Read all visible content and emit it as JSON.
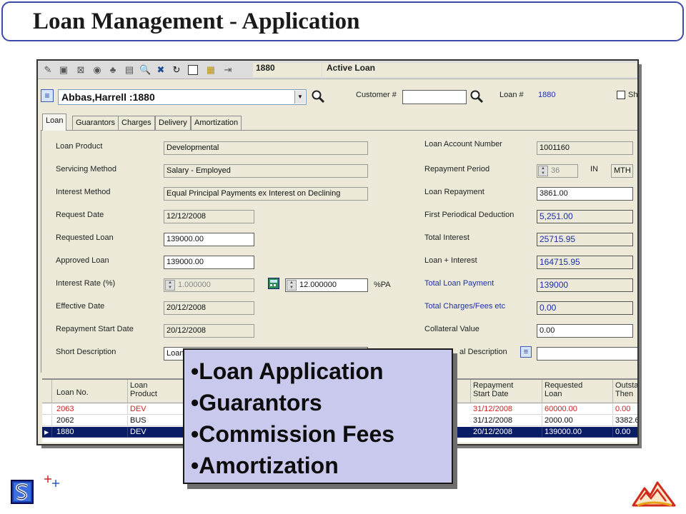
{
  "slide": {
    "title": "Loan Management - Application"
  },
  "toolbar": {
    "loan_number": "1880",
    "status": "Active Loan"
  },
  "search": {
    "borrower_combo": "Abbas,Harrell :1880",
    "customer_label": "Customer #",
    "customer_value": "",
    "loan_label": "Loan #",
    "loan_value": "1880",
    "show_label": "Sh"
  },
  "tabs": [
    {
      "label": "Loan",
      "active": true
    },
    {
      "label": "Guarantors"
    },
    {
      "label": "Charges"
    },
    {
      "label": "Delivery"
    },
    {
      "label": "Amortization"
    }
  ],
  "form_left": {
    "loan_product": {
      "label": "Loan Product",
      "value": "Developmental"
    },
    "servicing_method": {
      "label": "Servicing Method",
      "value": "Salary - Employed"
    },
    "interest_method": {
      "label": "Interest Method",
      "value": "Equal Principal Payments ex Interest on Declining"
    },
    "request_date": {
      "label": "Request Date",
      "value": "12/12/2008"
    },
    "requested_loan": {
      "label": "Requested Loan",
      "value": "139000.00"
    },
    "approved_loan": {
      "label": "Approved Loan",
      "value": "139000.00"
    },
    "interest_rate": {
      "label": "Interest Rate (%)",
      "value_1": "1.000000",
      "value_2": "12.000000",
      "unit": "%PA"
    },
    "effective_date": {
      "label": "Effective Date",
      "value": "20/12/2008"
    },
    "repayment_start_date": {
      "label": "Repayment Start Date",
      "value": "20/12/2008"
    },
    "short_description": {
      "label": "Short Description",
      "value": "Loan"
    }
  },
  "form_right": {
    "loan_account_number": {
      "label": "Loan Account Number",
      "value": "1001160"
    },
    "repayment_period": {
      "label": "Repayment Period",
      "value": "36",
      "in_label": "IN",
      "unit": "MTH"
    },
    "loan_repayment": {
      "label": "Loan Repayment",
      "value": "3861.00"
    },
    "first_periodical_deduction": {
      "label": "First Periodical Deduction",
      "value": "5,251.00"
    },
    "total_interest": {
      "label": "Total Interest",
      "value": "25715.95"
    },
    "loan_plus_interest": {
      "label": "Loan + Interest",
      "value": "164715.95"
    },
    "total_loan_payment": {
      "label": "Total Loan Payment",
      "value": "139000"
    },
    "total_charges_fees": {
      "label": "Total Charges/Fees etc",
      "value": "0.00"
    },
    "collateral_value": {
      "label": "Collateral Value",
      "value": "0.00"
    },
    "collateral_description": {
      "label": "al Description",
      "value": ""
    }
  },
  "grid": {
    "headers": {
      "loan_no": "Loan No.",
      "loan_product": "Loan\nProduct",
      "repayment_start_date": "Repayment\nStart Date",
      "requested_loan": "Requested\nLoan",
      "outstanding_then": "Outstar\nThen"
    },
    "rows": [
      {
        "loan_no": "2063",
        "product": "DEV",
        "start_date": "31/12/2008",
        "requested": "60000.00",
        "outstanding": "0.00"
      },
      {
        "loan_no": "2062",
        "product": "BUS",
        "start_date": "31/12/2008",
        "requested": "2000.00",
        "outstanding": "3382.6"
      },
      {
        "loan_no": "1880",
        "product": "DEV",
        "start_date": "20/12/2008",
        "requested": "139000.00",
        "outstanding": "0.00"
      }
    ]
  },
  "callout": {
    "items": [
      "Loan Application",
      "Guarantors",
      "Commission Fees",
      "Amortization"
    ]
  },
  "colors": {
    "title_border": "#3d4aa8",
    "callout_bg": "#c8c9ec",
    "selected_row": "#0b1c66",
    "alert_row_text": "#d32020",
    "value_blue": "#1c2fb0"
  }
}
